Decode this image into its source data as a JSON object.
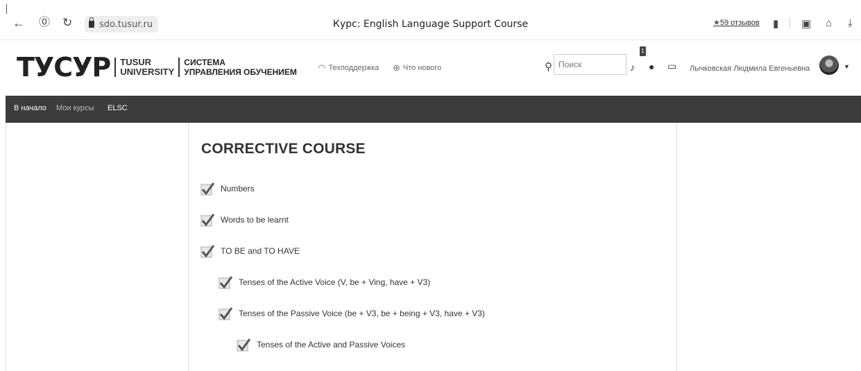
{
  "browser": {
    "back_icon": "arrow-left-icon",
    "url": "sdo.tusur.ru",
    "tab_title": "Курс: English Language Support Course",
    "reviews_label": "59 отзывов",
    "star_glyph": "★"
  },
  "header": {
    "logo_mark": "ТУСУР",
    "logo_univ_line1": "TUSUR",
    "logo_univ_line2": "UNIVERSITY",
    "system_line1": "СИСТЕМА",
    "system_line2": "УПРАВЛЕНИЯ ОБУЧЕНИЕМ",
    "support_label": "Техподдержка",
    "whats_new_label": "Что нового",
    "search_placeholder": "Поиск",
    "notification_count": "1",
    "user_name": "Лычковская Людмила Евгеньевна"
  },
  "navbar": {
    "home": "В начало",
    "my_courses": "Мои курсы",
    "elsc": "ELSC"
  },
  "main": {
    "course_title": "CORRECTIVE COURSE",
    "topics": [
      {
        "label": "Numbers",
        "level": 0
      },
      {
        "label": "Words to be learnt",
        "level": 0
      },
      {
        "label": "TO BE and TO HAVE",
        "level": 0
      },
      {
        "label": "Tenses of the Active Voice (V, be + Ving, have + V3)",
        "level": 1
      },
      {
        "label": "Tenses of the Passive Voice (be + V3, be + being + V3, have + V3)",
        "level": 1
      },
      {
        "label": "Tenses of the Active and Passive Voices",
        "level": 2
      }
    ]
  },
  "colors": {
    "navbar_bg": "#3c3c3c",
    "text": "#333333"
  }
}
